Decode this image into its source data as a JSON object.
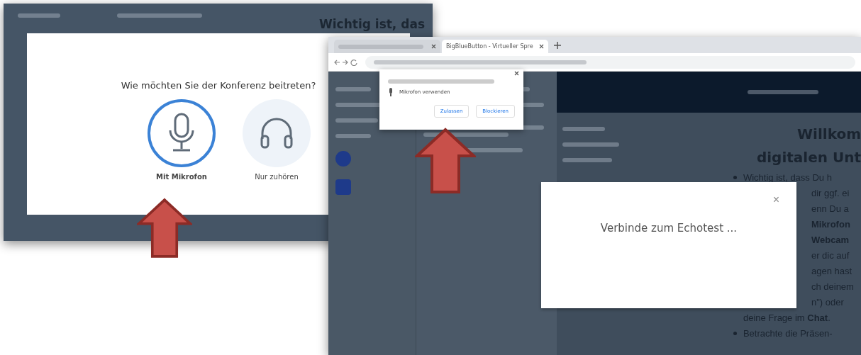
{
  "left_screenshot": {
    "background_heading": "Wichtig ist, das",
    "dialog": {
      "title": "Wie möchten Sie der Konferenz beitreten?",
      "options": [
        {
          "kind": "microphone",
          "label": "Mit Mikrofon",
          "selected": true
        },
        {
          "kind": "listen",
          "label": "Nur zuhören",
          "selected": false
        }
      ]
    }
  },
  "right_screenshot": {
    "tabs": [
      {
        "selected": false
      },
      {
        "label": "BigBlueButton - Virtueller Spre",
        "selected": true
      }
    ],
    "permission_popup": {
      "permission": "Mikrofon verwenden",
      "buttons": [
        "Zulassen",
        "Blockieren"
      ]
    },
    "welcome_heading": [
      "Willkom",
      "digitalen Unt"
    ],
    "content_lines": [
      {
        "kind": "bullet",
        "text": "Wichtig ist, dass Du h"
      },
      {
        "kind": "line",
        "text": "dir ggf. ei"
      },
      {
        "kind": "line",
        "text": "enn Du a"
      },
      {
        "kind": "line",
        "text": "**Mikrofon**"
      },
      {
        "kind": "line",
        "text": "**Webcam**"
      },
      {
        "kind": "line",
        "text": "er dic auf"
      },
      {
        "kind": "line",
        "text": "agen hast"
      },
      {
        "kind": "line",
        "text": "ch deinem"
      },
      {
        "kind": "line",
        "text": "n\") oder"
      },
      {
        "kind": "line",
        "text": "deine Frage im **Chat**."
      },
      {
        "kind": "bullet",
        "text": "Betrachte die Präsen-"
      }
    ],
    "echo_dialog": {
      "message": "Verbinde zum Echotest ...",
      "close": "×"
    }
  }
}
